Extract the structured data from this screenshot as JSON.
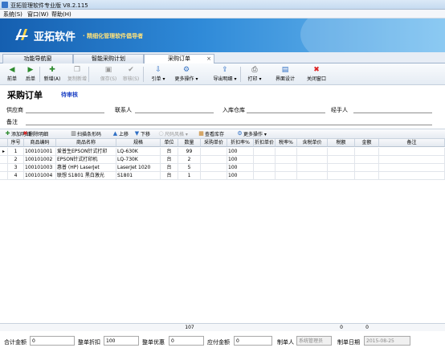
{
  "window": {
    "title": "亚拓管理软件专业版 V8.2.115"
  },
  "menu": {
    "items": [
      "系统(S)",
      "窗口(W)",
      "帮助(H)"
    ]
  },
  "banner": {
    "brand": "亚拓软件",
    "slogan": "· 精细化管理软件倡导者"
  },
  "tabs": [
    {
      "label": "功能导航窗"
    },
    {
      "label": "智能采购计划"
    },
    {
      "label": "采购订单"
    }
  ],
  "tab_close_glyph": "×",
  "toolbar": {
    "buttons": [
      {
        "label": "前单",
        "icon": "arrow-left-icon",
        "glyph": "◀",
        "color": "#2e8b2e"
      },
      {
        "label": "后单",
        "icon": "arrow-right-icon",
        "glyph": "▶",
        "color": "#2e8b2e"
      },
      {
        "label": "新增(A)",
        "icon": "add-icon",
        "glyph": "✚",
        "color": "#2e8b2e"
      },
      {
        "label": "复制新增",
        "icon": "copy-icon",
        "glyph": "❐",
        "color": "#9a9a9a"
      },
      {
        "label": "保存(S)",
        "icon": "save-icon",
        "glyph": "▣",
        "color": "#9a9a9a"
      },
      {
        "label": "审核(S)",
        "icon": "audit-icon",
        "glyph": "✔",
        "color": "#9a9a9a"
      },
      {
        "label": "引单 ▾",
        "icon": "import-icon",
        "glyph": "⇩",
        "color": "#2f6fc4"
      },
      {
        "label": "更多操作 ▾",
        "icon": "more-ops-icon",
        "glyph": "⚙",
        "color": "#2f6fc4"
      },
      {
        "label": "导出明细 ▾",
        "icon": "export-icon",
        "glyph": "⇪",
        "color": "#2f6fc4"
      },
      {
        "label": "打印 ▾",
        "icon": "print-icon",
        "glyph": "⎙",
        "color": "#444444"
      },
      {
        "label": "界面设计",
        "icon": "design-icon",
        "glyph": "▤",
        "color": "#2f6fc4"
      },
      {
        "label": "关闭窗口",
        "icon": "close-window-icon",
        "glyph": "✖",
        "color": "#d22"
      }
    ]
  },
  "document": {
    "title": "采购订单",
    "status": "待审核"
  },
  "form": {
    "supplier_label": "供应商",
    "contact_label": "联系人",
    "warehouse_label": "入库仓库",
    "handler_label": "经手人",
    "remark_label": "备注"
  },
  "grid_toolbar": [
    {
      "label": "添加明细",
      "icon": "add-detail-icon",
      "glyph": "✚",
      "color": "#2e8b2e"
    },
    {
      "label": "删除明细",
      "icon": "delete-detail-icon",
      "glyph": "✖",
      "color": "#d22"
    },
    {
      "label": "扫描条形码",
      "icon": "barcode-icon",
      "glyph": "▥",
      "color": "#555555"
    },
    {
      "label": "上移",
      "icon": "move-up-icon",
      "glyph": "▲",
      "color": "#2f6fc4"
    },
    {
      "label": "下移",
      "icon": "move-down-icon",
      "glyph": "▼",
      "color": "#2f6fc4"
    },
    {
      "label": "尺码风格 ▾",
      "icon": "size-style-icon",
      "glyph": "◌",
      "color": "#9a9a9a"
    },
    {
      "label": "查看库存",
      "icon": "view-stock-icon",
      "glyph": "▦",
      "color": "#c47a16"
    },
    {
      "label": "更多操作 ▾",
      "icon": "grid-more-icon",
      "glyph": "⚙",
      "color": "#2f6fc4"
    }
  ],
  "grid": {
    "columns": [
      "序号",
      "商品编码",
      "商品名称",
      "规格",
      "单位",
      "数量",
      "采购单价",
      "折扣率%",
      "折扣单价",
      "税率%",
      "含税单价",
      "税额",
      "金额",
      "备注"
    ],
    "current_row_marker": "▸",
    "rows": [
      [
        "1",
        "100101001",
        "爱普生EPSON针式打印",
        "LQ-630K",
        "台",
        "99",
        "",
        "100",
        "",
        "",
        "",
        "",
        "",
        ""
      ],
      [
        "2",
        "100101002",
        "EPSON针式打印机",
        "LQ-730K",
        "台",
        "2",
        "",
        "100",
        "",
        "",
        "",
        "",
        "",
        ""
      ],
      [
        "3",
        "100101003",
        "惠普 (HP) LaserJet",
        "LaserJet 1020",
        "台",
        "5",
        "",
        "100",
        "",
        "",
        "",
        "",
        "",
        ""
      ],
      [
        "4",
        "100101004",
        "联想 S1801 黑白激光",
        "S1801",
        "台",
        "1",
        "",
        "100",
        "",
        "",
        "",
        "",
        "",
        ""
      ]
    ],
    "footer": {
      "quantity_total": "107",
      "tax_total": "0",
      "amount_total": "0"
    }
  },
  "bottom": {
    "total_amount_label": "合计金额",
    "total_amount": "0",
    "discount_label": "整单折扣",
    "discount": "100",
    "offer_label": "整单优惠",
    "offer": "0",
    "payable_label": "应付金额",
    "payable": "0",
    "creator_label": "制单人",
    "creator": "系统管理员",
    "date_label": "制单日期",
    "date": "2015-08-25"
  }
}
